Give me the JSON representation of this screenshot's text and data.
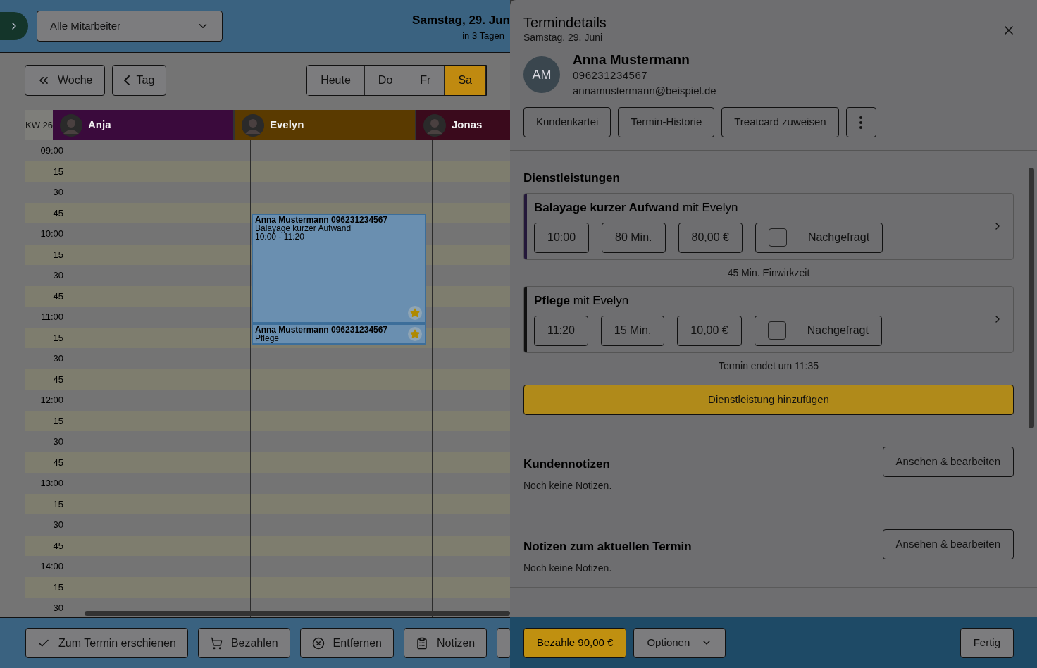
{
  "toolbar": {
    "employee_select": {
      "value": "Alle Mitarbeiter"
    },
    "date_title": "Samstag, 29. Jun",
    "date_hint": "in 3 Tagen"
  },
  "nav_buttons": [
    {
      "label": "Woche",
      "kind": "week"
    },
    {
      "label": "Tag",
      "kind": "day"
    }
  ],
  "day_tabs": [
    {
      "label": "Heute",
      "selected": false
    },
    {
      "label": "Do",
      "selected": false
    },
    {
      "label": "Fr",
      "selected": false
    },
    {
      "label": "Sa",
      "selected": true
    }
  ],
  "calendar": {
    "week_label": "KW 26",
    "employees": [
      {
        "name": "Anja",
        "color": "#3a0a3c"
      },
      {
        "name": "Evelyn",
        "color": "#5a3a00"
      },
      {
        "name": "Jonas",
        "color": "#3a0a1c"
      }
    ],
    "times": [
      "09:00",
      "15",
      "30",
      "45",
      "10:00",
      "15",
      "30",
      "45",
      "11:00",
      "15",
      "30",
      "45",
      "12:00",
      "15",
      "30",
      "45",
      "13:00",
      "15",
      "30",
      "45",
      "14:00",
      "15",
      "30"
    ],
    "appointments": [
      {
        "title": "Anna Mustermann 096231234567",
        "service": "Balayage kurzer Aufwand",
        "time": "10:00 - 11:20"
      },
      {
        "title": "Anna Mustermann 096231234567",
        "service": "Pflege"
      }
    ]
  },
  "action_bar": [
    {
      "label": "Zum Termin erschienen",
      "kind": "check"
    },
    {
      "label": "Bezahlen",
      "kind": "cart"
    },
    {
      "label": "Entfernen",
      "kind": "remove"
    },
    {
      "label": "Notizen",
      "kind": "notes"
    },
    {
      "kind": "cut"
    }
  ],
  "details": {
    "title": "Termindetails",
    "subtitle": "Samstag, 29. Juni",
    "customer": {
      "initials": "AM",
      "name": "Anna Mustermann",
      "phone": "096231234567",
      "email": "annamustermann@beispiel.de"
    },
    "customer_buttons": [
      "Kundenkartei",
      "Termin-Historie",
      "Treatcard zuweisen"
    ],
    "services_heading": "Dienstleistungen",
    "services": [
      {
        "title": "**Balayage kurzer Aufwand** mit Evelyn",
        "color": "#24183a",
        "time": "10:00",
        "duration": "80 Min.",
        "price": "80,00 €",
        "requested": {
          "label": "Nachgefragt",
          "checked": false
        },
        "note": "45 Min. Einwirkzeit"
      },
      {
        "title": "**Pflege** mit Evelyn",
        "color": "#111111",
        "time": "11:20",
        "duration": "15 Min.",
        "price": "10,00 €",
        "requested": {
          "label": "Nachgefragt",
          "checked": false
        },
        "note": "Termin endet um 11:35"
      }
    ],
    "add_service": "Dienstleistung hinzufügen",
    "note_sections": [
      {
        "heading": "Kundennotizen",
        "button": "Ansehen & bearbeiten",
        "text": "Noch keine Notizen."
      },
      {
        "heading": "Notizen zum aktuellen Termin",
        "button": "Ansehen & bearbeiten",
        "text": "Noch keine Notizen."
      }
    ],
    "footer": {
      "pay": "Bezahle 90,00 €",
      "options": "Optionen",
      "done": "Fertig"
    }
  }
}
